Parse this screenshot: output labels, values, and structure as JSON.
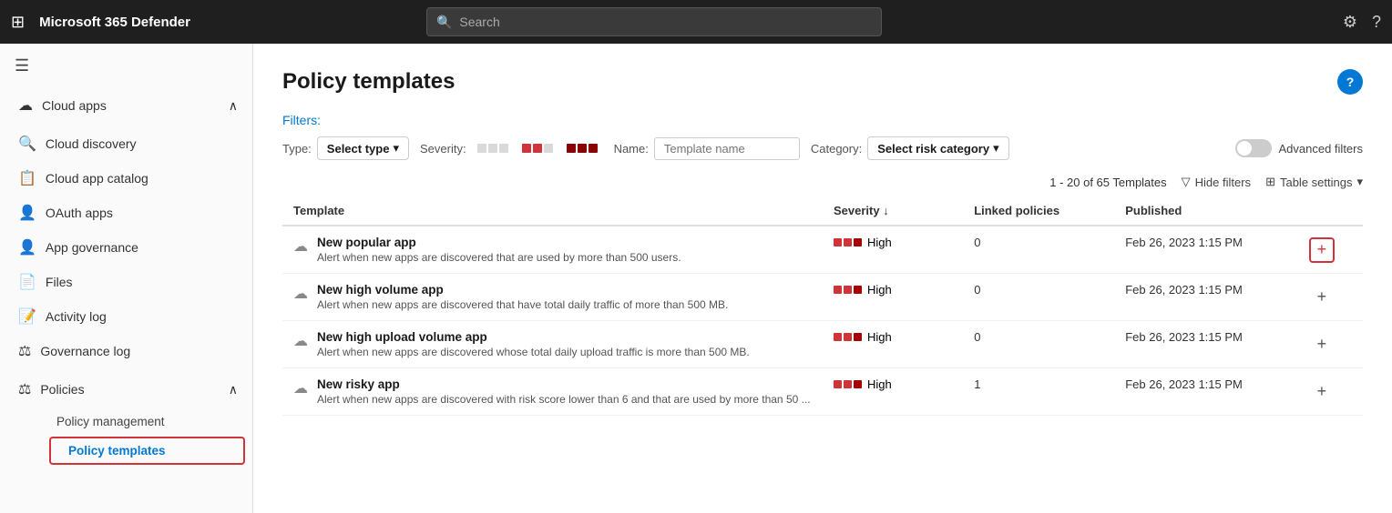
{
  "app": {
    "title": "Microsoft 365 Defender"
  },
  "topnav": {
    "search_placeholder": "Search",
    "settings_label": "Settings",
    "help_label": "Help"
  },
  "sidebar": {
    "hamburger_label": "Menu",
    "cloud_apps_label": "Cloud apps",
    "items": [
      {
        "id": "cloud-discovery",
        "label": "Cloud discovery",
        "icon": "🔍"
      },
      {
        "id": "cloud-app-catalog",
        "label": "Cloud app catalog",
        "icon": "📋"
      },
      {
        "id": "oauth-apps",
        "label": "OAuth apps",
        "icon": "👤"
      },
      {
        "id": "app-governance",
        "label": "App governance",
        "icon": "👤"
      },
      {
        "id": "files",
        "label": "Files",
        "icon": "📄"
      },
      {
        "id": "activity-log",
        "label": "Activity log",
        "icon": "📝"
      },
      {
        "id": "governance-log",
        "label": "Governance log",
        "icon": "⚖"
      }
    ],
    "policies_label": "Policies",
    "policy_sub_items": [
      {
        "id": "policy-management",
        "label": "Policy management"
      },
      {
        "id": "policy-templates",
        "label": "Policy templates",
        "active": true
      }
    ]
  },
  "page": {
    "title": "Policy templates",
    "help_label": "?"
  },
  "filters": {
    "label": "Filters:",
    "type_label": "Type:",
    "type_value": "Select type",
    "severity_label": "Severity:",
    "name_label": "Name:",
    "name_placeholder": "Template name",
    "category_label": "Category:",
    "category_value": "Select risk category",
    "advanced_label": "Advanced filters"
  },
  "table": {
    "count_text": "1 - 20 of 65 Templates",
    "hide_filters_label": "Hide filters",
    "table_settings_label": "Table settings",
    "columns": {
      "template": "Template",
      "severity": "Severity",
      "linked_policies": "Linked policies",
      "published": "Published"
    },
    "rows": [
      {
        "name": "New popular app",
        "desc": "Alert when new apps are discovered that are used by more than 500 users.",
        "severity_label": "High",
        "linked": "0",
        "published": "Feb 26, 2023 1:15 PM",
        "highlight_add": true
      },
      {
        "name": "New high volume app",
        "desc": "Alert when new apps are discovered that have total daily traffic of more than 500 MB.",
        "severity_label": "High",
        "linked": "0",
        "published": "Feb 26, 2023 1:15 PM",
        "highlight_add": false
      },
      {
        "name": "New high upload volume app",
        "desc": "Alert when new apps are discovered whose total daily upload traffic is more than 500 MB.",
        "severity_label": "High",
        "linked": "0",
        "published": "Feb 26, 2023 1:15 PM",
        "highlight_add": false
      },
      {
        "name": "New risky app",
        "desc": "Alert when new apps are discovered with risk score lower than 6 and that are used by more than 50 ...",
        "severity_label": "High",
        "linked": "1",
        "published": "Feb 26, 2023 1:15 PM",
        "highlight_add": false
      }
    ]
  }
}
